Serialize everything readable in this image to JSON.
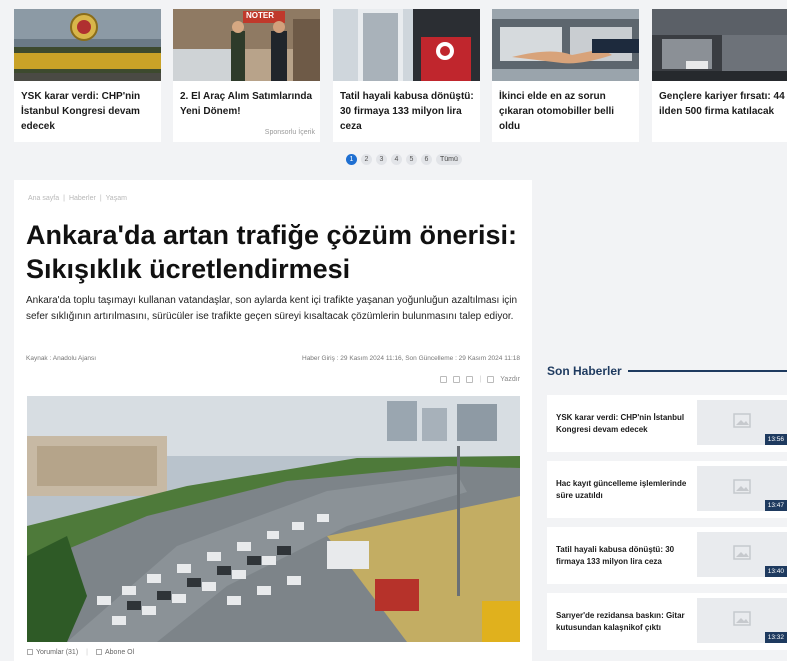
{
  "slider": {
    "cards": [
      {
        "title": "YSK karar verdi: CHP'nin İstanbul Kongresi devam edecek"
      },
      {
        "title": "2. El Araç Alım Satımlarında Yeni Dönem!",
        "sponsor": "Sponsorlu İçerik",
        "sign": "NOTER"
      },
      {
        "title": "Tatil hayali kabusa dönüştü: 30 firmaya 133 milyon lira ceza"
      },
      {
        "title": "İkinci elde en az sorun çıkaran otomobiller belli oldu"
      },
      {
        "title": "Gençlere kariyer fırsatı: 44 ilden 500 firma katılacak"
      }
    ],
    "pages": [
      "1",
      "2",
      "3",
      "4",
      "5",
      "6"
    ],
    "all_label": "Tümü"
  },
  "article": {
    "breadcrumb": [
      "Ana sayfa",
      "Haberler",
      "Yaşam"
    ],
    "headline": "Ankara'da artan trafiğe çözüm önerisi: Sıkışıklık ücretlendirmesi",
    "lead": "Ankara'da toplu taşımayı kullanan vatandaşlar, son aylarda kent içi trafikte yaşanan yoğunluğun azaltılması için sefer sıklığının artırılmasını, sürücüler ise trafikte geçen süreyi kısaltacak çözümlerin bulunmasını talep ediyor.",
    "source": "Kaynak : Anadolu Ajansı",
    "dates": "Haber Giriş : 29 Kasım 2024 11:16, Son Güncelleme : 29 Kasım 2024 11:18",
    "print_label": "Yazdır",
    "comments_label": "Yorumlar (31)",
    "subscribe_label": "Abone Ol"
  },
  "sidebar": {
    "heading": "Son Haberler",
    "items": [
      {
        "title": "YSK karar verdi: CHP'nin İstanbul Kongresi devam edecek",
        "time": "13:56"
      },
      {
        "title": "Hac kayıt güncelleme işlemlerinde süre uzatıldı",
        "time": "13:47"
      },
      {
        "title": "Tatil hayali kabusa dönüştü: 30 firmaya 133 milyon lira ceza",
        "time": "13:40"
      },
      {
        "title": "Sarıyer'de rezidansa baskın: Gitar kutusundan kalaşnikof çıktı",
        "time": "13:32"
      }
    ]
  },
  "colors": {
    "accent": "#1f6fd1",
    "navy": "#1e3a5f"
  }
}
